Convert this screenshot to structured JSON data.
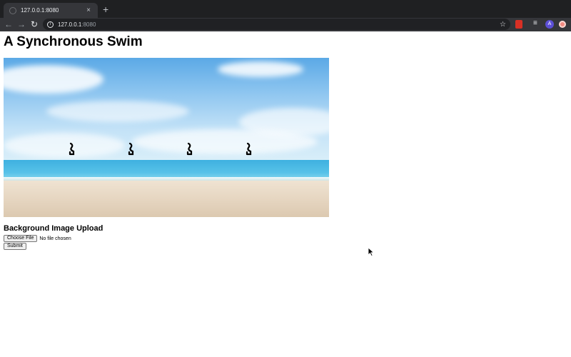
{
  "browser": {
    "tab_title": "127.0.0.1:8080",
    "tab_close": "×",
    "new_tab": "+",
    "url_host": "127.0.0.1",
    "url_port": ":8080",
    "avatar_letter": "A"
  },
  "page": {
    "title": "A Synchronous Swim"
  },
  "upload": {
    "heading": "Background Image Upload",
    "choose_label": "Choose File",
    "file_status": "No file chosen",
    "submit_label": "Submit"
  },
  "colors": {
    "chrome_dark": "#1f2022",
    "toolbar": "#35363a",
    "sky": "#5ba9e6",
    "sea": "#3fb1e0",
    "sand": "#e6d6c1"
  },
  "icons": [
    "back-icon",
    "forward-icon",
    "reload-icon",
    "info-icon",
    "star-icon",
    "swimmer-icon"
  ]
}
